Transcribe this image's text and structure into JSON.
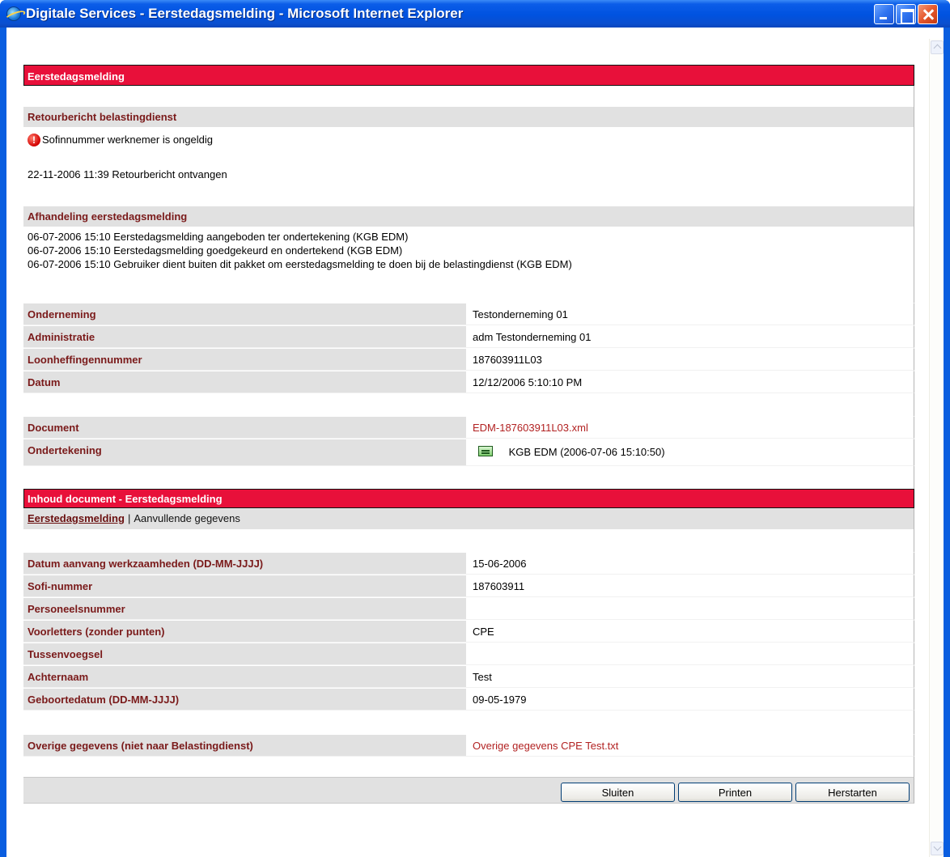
{
  "window": {
    "title": "Digitale Services - Eerstedagsmelding - Microsoft Internet Explorer"
  },
  "header": {
    "title": "Eerstedagsmelding"
  },
  "retour": {
    "title": "Retourbericht belastingdienst",
    "error_message": "Sofinnummer werknemer is ongeldig",
    "received_line": "22-11-2006 11:39 Retourbericht ontvangen"
  },
  "afhandeling": {
    "title": "Afhandeling eerstedagsmelding",
    "lines": [
      "06-07-2006 15:10 Eerstedagsmelding aangeboden ter ondertekening (KGB EDM)",
      "06-07-2006 15:10 Eerstedagsmelding goedgekeurd en ondertekend (KGB EDM)",
      "06-07-2006 15:10 Gebruiker dient buiten dit pakket om eerstedagsmelding te doen bij de belastingdienst (KGB EDM)"
    ]
  },
  "company": {
    "rows": [
      {
        "label": "Onderneming",
        "value": "Testonderneming 01"
      },
      {
        "label": "Administratie",
        "value": "adm Testonderneming 01"
      },
      {
        "label": "Loonheffingennummer",
        "value": "187603911L03"
      },
      {
        "label": "Datum",
        "value": "12/12/2006 5:10:10 PM"
      }
    ]
  },
  "document": {
    "label": "Document",
    "value": "EDM-187603911L03.xml",
    "signature_label": "Ondertekening",
    "signature_icon": "signature-certificate-icon",
    "signature_value": "KGB EDM (2006-07-06 15:10:50)"
  },
  "inhoud": {
    "title": "Inhoud document - Eerstedagsmelding",
    "tab_active": "Eerstedagsmelding",
    "tab_separator": "|",
    "tab_other": "Aanvullende gegevens",
    "rows": [
      {
        "label": "Datum aanvang werkzaamheden (DD-MM-JJJJ)",
        "value": "15-06-2006"
      },
      {
        "label": "Sofi-nummer",
        "value": "187603911"
      },
      {
        "label": "Personeelsnummer",
        "value": ""
      },
      {
        "label": "Voorletters (zonder punten)",
        "value": "CPE"
      },
      {
        "label": "Tussenvoegsel",
        "value": ""
      },
      {
        "label": "Achternaam",
        "value": "Test"
      },
      {
        "label": "Geboortedatum (DD-MM-JJJJ)",
        "value": "09-05-1979"
      }
    ],
    "overige_label": "Overige gegevens (niet naar Belastingdienst)",
    "overige_value": "Overige gegevens CPE Test.txt"
  },
  "buttons": {
    "close": "Sluiten",
    "print": "Printen",
    "restart": "Herstarten"
  },
  "colors": {
    "header_red": "#e8103a",
    "section_gray": "#e1e1e1",
    "label_maroon": "#7a1a1a",
    "link_red": "#b22222",
    "titlebar_blue": "#0052e0"
  }
}
